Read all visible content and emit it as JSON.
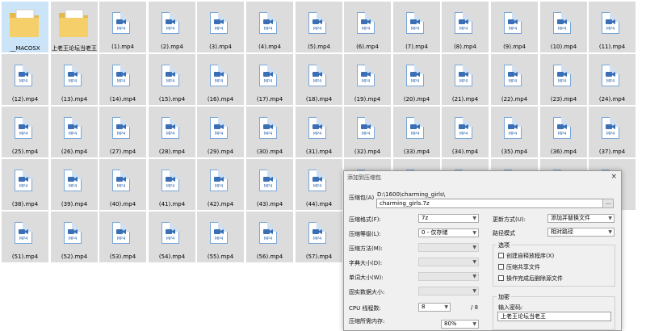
{
  "files": [
    {
      "name": "__MACOSX",
      "kind": "folder",
      "selected": true
    },
    {
      "name": "上老王论坛当老王",
      "kind": "folder"
    },
    {
      "name": "(1).mp4",
      "kind": "mp4"
    },
    {
      "name": "(2).mp4",
      "kind": "mp4"
    },
    {
      "name": "(3).mp4",
      "kind": "mp4"
    },
    {
      "name": "(4).mp4",
      "kind": "mp4"
    },
    {
      "name": "(5).mp4",
      "kind": "mp4"
    },
    {
      "name": "(6).mp4",
      "kind": "mp4"
    },
    {
      "name": "(7).mp4",
      "kind": "mp4"
    },
    {
      "name": "(8).mp4",
      "kind": "mp4"
    },
    {
      "name": "(9).mp4",
      "kind": "mp4"
    },
    {
      "name": "(10).mp4",
      "kind": "mp4"
    },
    {
      "name": "(11).mp4",
      "kind": "mp4"
    },
    {
      "name": "(12).mp4",
      "kind": "mp4"
    },
    {
      "name": "(13).mp4",
      "kind": "mp4"
    },
    {
      "name": "(14).mp4",
      "kind": "mp4"
    },
    {
      "name": "(15).mp4",
      "kind": "mp4"
    },
    {
      "name": "(16).mp4",
      "kind": "mp4"
    },
    {
      "name": "(17).mp4",
      "kind": "mp4"
    },
    {
      "name": "(18).mp4",
      "kind": "mp4"
    },
    {
      "name": "(19).mp4",
      "kind": "mp4"
    },
    {
      "name": "(20).mp4",
      "kind": "mp4"
    },
    {
      "name": "(21).mp4",
      "kind": "mp4"
    },
    {
      "name": "(22).mp4",
      "kind": "mp4"
    },
    {
      "name": "(23).mp4",
      "kind": "mp4"
    },
    {
      "name": "(24).mp4",
      "kind": "mp4"
    },
    {
      "name": "(25).mp4",
      "kind": "mp4"
    },
    {
      "name": "(26).mp4",
      "kind": "mp4"
    },
    {
      "name": "(27).mp4",
      "kind": "mp4"
    },
    {
      "name": "(28).mp4",
      "kind": "mp4"
    },
    {
      "name": "(29).mp4",
      "kind": "mp4"
    },
    {
      "name": "(30).mp4",
      "kind": "mp4"
    },
    {
      "name": "(31).mp4",
      "kind": "mp4"
    },
    {
      "name": "(32).mp4",
      "kind": "mp4"
    },
    {
      "name": "(33).mp4",
      "kind": "mp4"
    },
    {
      "name": "(34).mp4",
      "kind": "mp4"
    },
    {
      "name": "(35).mp4",
      "kind": "mp4"
    },
    {
      "name": "(36).mp4",
      "kind": "mp4"
    },
    {
      "name": "(37).mp4",
      "kind": "mp4"
    },
    {
      "name": "(38).mp4",
      "kind": "mp4"
    },
    {
      "name": "(39).mp4",
      "kind": "mp4"
    },
    {
      "name": "(40).mp4",
      "kind": "mp4"
    },
    {
      "name": "(41).mp4",
      "kind": "mp4"
    },
    {
      "name": "(42).mp4",
      "kind": "mp4"
    },
    {
      "name": "(43).mp4",
      "kind": "mp4"
    },
    {
      "name": "(44).mp4",
      "kind": "mp4"
    },
    {
      "name": "",
      "kind": "mp4"
    },
    {
      "name": "",
      "kind": "mp4"
    },
    {
      "name": "",
      "kind": "mp4"
    },
    {
      "name": "",
      "kind": "mp4"
    },
    {
      "name": "",
      "kind": "mp4"
    },
    {
      "name": "",
      "kind": "mp4"
    },
    {
      "name": "(51).mp4",
      "kind": "mp4"
    },
    {
      "name": "(52).mp4",
      "kind": "mp4"
    },
    {
      "name": "(53).mp4",
      "kind": "mp4"
    },
    {
      "name": "(54).mp4",
      "kind": "mp4"
    },
    {
      "name": "(55).mp4",
      "kind": "mp4"
    },
    {
      "name": "(56).mp4",
      "kind": "mp4"
    },
    {
      "name": "(57).mp4",
      "kind": "mp4"
    }
  ],
  "file_icon_label": "MP4",
  "dialog": {
    "title": "添加到压缩包",
    "archive_label": "压缩包(A)",
    "archive_path": "D:\\1600\\charming_girls\\",
    "archive_name": "charming_girls.7z",
    "browse_label": "...",
    "format_label": "压缩格式(F):",
    "format_value": "7z",
    "level_label": "压缩等级(L):",
    "level_value": "0 - 仅存储",
    "method_label": "压缩方法(M):",
    "dict_label": "字典大小(D):",
    "word_label": "单词大小(W):",
    "solid_label": "固实数据大小:",
    "cpu_label": "CPU 线程数:",
    "cpu_value": "8",
    "cpu_max": "/ 8",
    "memory_label": "压缩所需内存:",
    "memory_value": "80%",
    "update_label": "更新方式(U):",
    "update_value": "添加并替换文件",
    "path_label": "路径模式",
    "path_value": "相对路径",
    "options_title": "选项",
    "opt_sfx": "创建自释放程序(X)",
    "opt_shared": "压缩共享文件",
    "opt_delete": "操作完成后删除源文件",
    "encrypt_title": "加密",
    "password_label": "输入密码:",
    "password_value": "上老王论坛当老王",
    "close_label": "×"
  }
}
